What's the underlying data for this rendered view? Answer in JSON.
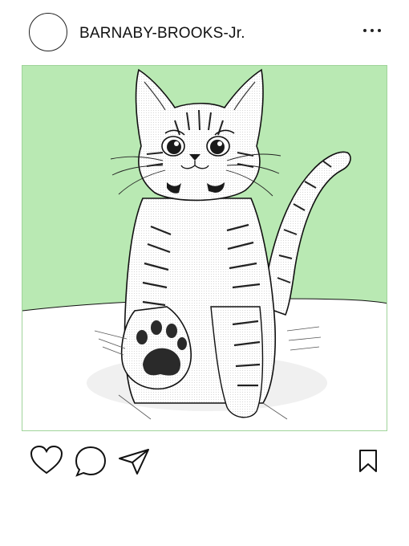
{
  "post": {
    "username": "BARNABY-BROOKS-Jr.",
    "image_subject": "cat-illustration",
    "background_color": "#b9e9b3"
  },
  "icons": {
    "more": "more-horizontal-icon",
    "like": "heart-icon",
    "comment": "speech-bubble-icon",
    "share": "paper-plane-icon",
    "save": "bookmark-icon"
  }
}
